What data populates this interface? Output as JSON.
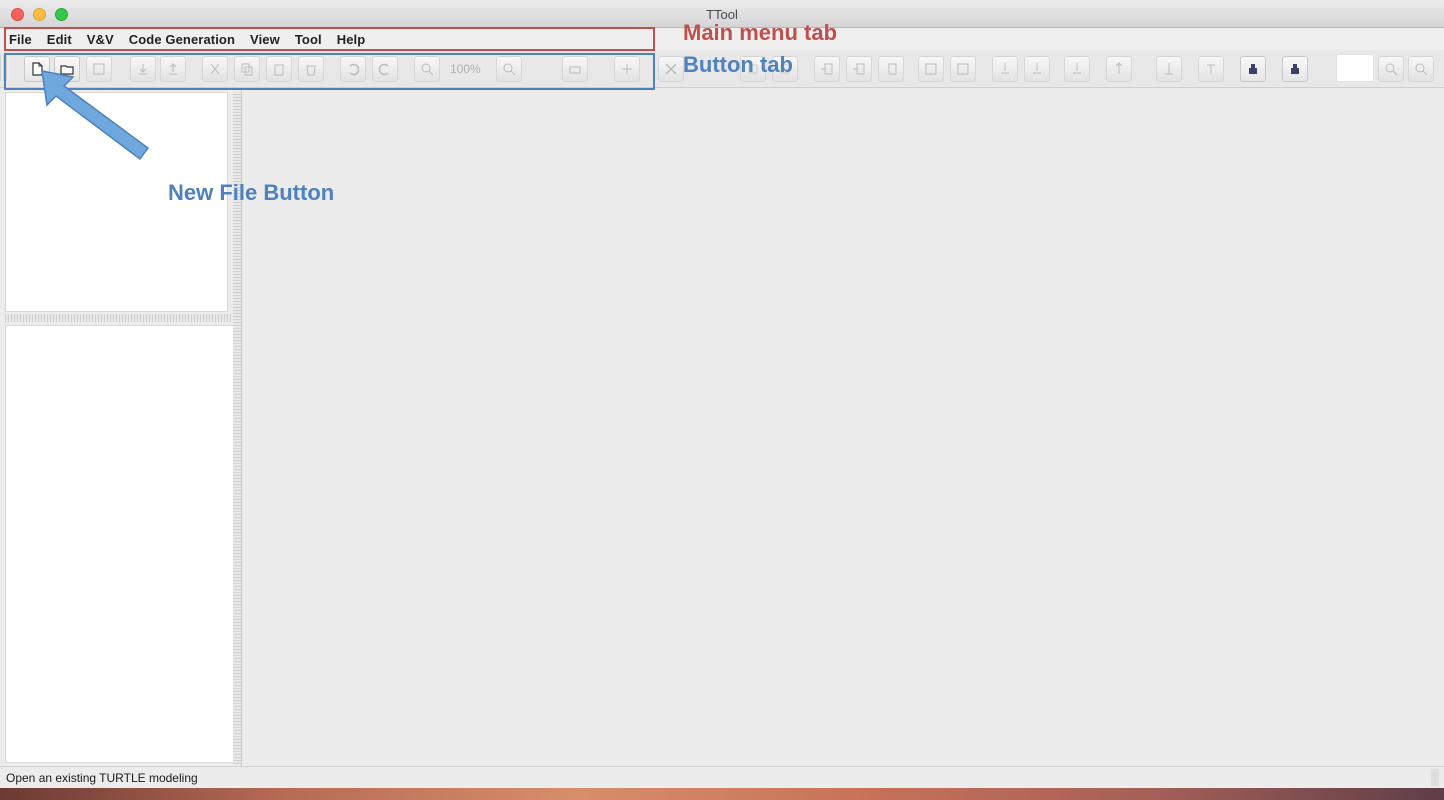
{
  "window": {
    "title": "TTool"
  },
  "menubar": {
    "items": [
      "File",
      "Edit",
      "V&V",
      "Code Generation",
      "View",
      "Tool",
      "Help"
    ]
  },
  "toolbar": {
    "zoom_level": "100%"
  },
  "statusbar": {
    "text": "Open an existing TURTLE modeling"
  },
  "annotations": {
    "main_menu": "Main menu tab",
    "button_tab": "Button tab",
    "new_file": "New File Button",
    "colors": {
      "red": "#c0504d",
      "blue": "#4f81bd",
      "arrow": "#6fa8dc"
    }
  }
}
